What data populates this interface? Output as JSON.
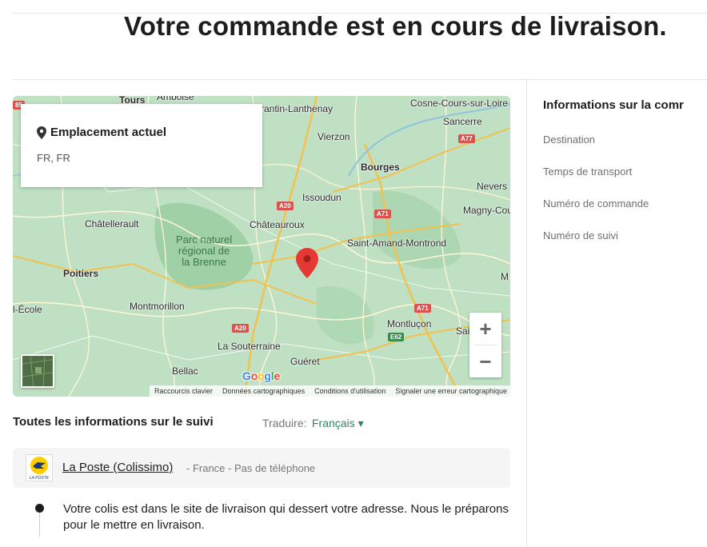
{
  "page": {
    "title": "Votre commande est en cours de livraison."
  },
  "map": {
    "location_card": {
      "title": "Emplacement actuel",
      "value": "FR, FR"
    },
    "labels": {
      "tours": "Tours",
      "amboise": "Amboise",
      "romorantin": "rantin-Lanthenay",
      "cosne": "Cosne-Cours-sur-Loire",
      "sancerre": "Sancerre",
      "vierzon": "Vierzon",
      "bourges": "Bourges",
      "issoudun": "Issoudun",
      "nevers": "Nevers",
      "chatellerault": "Châtellerault",
      "chateauroux": "Châteauroux",
      "magny": "Magny-Cou",
      "parc": "Parc naturel\nrégional de\nla Brenne",
      "saint_amand": "Saint-Amand-Montrond",
      "poitiers": "Poitiers",
      "ecole": "l-École",
      "montmorillon": "Montmorillon",
      "montlucon": "Montluçon",
      "la_souterraine": "La Souterraine",
      "bellac": "Bellac",
      "gueret": "Guéret",
      "m_edge": "M",
      "sai_edge": "Sai",
      "edge_85": "85"
    },
    "roads": {
      "a77": "A77",
      "a20_top": "A20",
      "a71_top": "A71",
      "a71_bottom": "A71",
      "a20_bottom": "A20",
      "e62": "E62"
    },
    "zoom_in": "+",
    "zoom_out": "−",
    "google": "Google",
    "attribution": {
      "shortcuts": "Raccourcis clavier",
      "data": "Données cartographiques",
      "terms": "Conditions d'utilisation",
      "report": "Signaler une erreur cartographique"
    }
  },
  "tracking": {
    "header": "Toutes les informations sur le suivi",
    "translate_label": "Traduire:",
    "translate_value": "Français ▾",
    "carrier": {
      "name": "La Poste (Colissimo)",
      "meta": "- France  - Pas de téléphone",
      "logo_text": "LA POSTE"
    },
    "events": [
      {
        "text": "Votre colis est dans le site de livraison qui dessert votre adresse. Nous le préparons pour le mettre en livraison."
      }
    ]
  },
  "order_info": {
    "title": "Informations sur la comr",
    "rows": [
      "Destination",
      "Temps de transport",
      "Numéro de commande",
      "Numéro de suivi"
    ]
  },
  "colors": {
    "accent_green": "#2b8a5a",
    "map_green": "#b9dcbf",
    "marker_red": "#e53935"
  },
  "icons": {
    "location_pin": "location-pin-icon",
    "map_marker": "map-marker-icon"
  }
}
